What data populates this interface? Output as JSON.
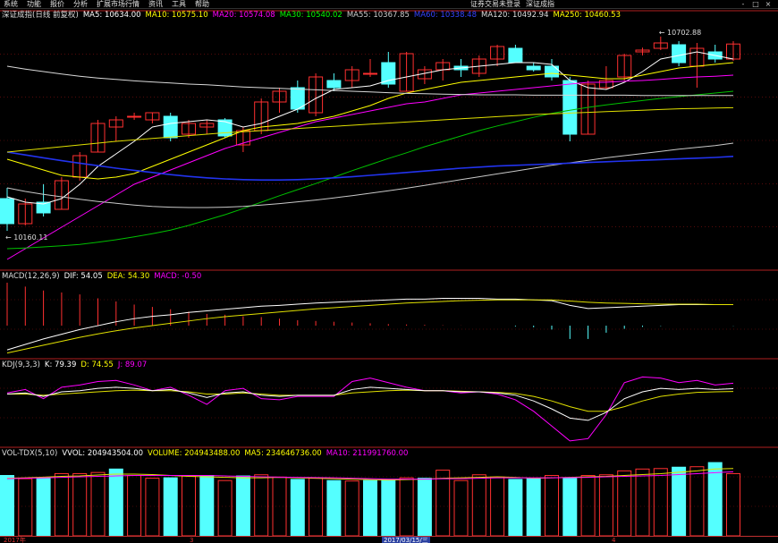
{
  "menu": {
    "items": [
      "系统",
      "功能",
      "报价",
      "分析",
      "扩展市场行情",
      "资讯",
      "工具",
      "帮助"
    ],
    "account_status": "证券交易未登录",
    "index_name": "深证成指"
  },
  "window_controls": [
    "-",
    "□",
    "×"
  ],
  "main_panel": {
    "title": "深证成指(日线 前复权)",
    "indicators": [
      {
        "label": "MA5: 10634.00",
        "color": "#ffffff"
      },
      {
        "label": "MA10: 10575.10",
        "color": "#ffff00"
      },
      {
        "label": "MA20: 10574.08",
        "color": "#ff00ff"
      },
      {
        "label": "MA30: 10540.02",
        "color": "#00ff00"
      },
      {
        "label": "MA55: 10367.85",
        "color": "#cccccc"
      },
      {
        "label": "MA60: 10338.48",
        "color": "#3344ff"
      },
      {
        "label": "MA120: 10492.94",
        "color": "#dddddd"
      },
      {
        "label": "MA250: 10460.53",
        "color": "#ffff00"
      }
    ],
    "high_marker": "10702.88",
    "low_marker": "10160.11"
  },
  "macd_panel": {
    "title": "MACD(12,26,9)",
    "indicators": [
      {
        "label": "DIF: 54.05",
        "color": "#ffffff"
      },
      {
        "label": "DEA: 54.30",
        "color": "#ffff00"
      },
      {
        "label": "MACD: -0.50",
        "color": "#ff00ff"
      }
    ]
  },
  "kdj_panel": {
    "title": "KDJ(9,3,3)",
    "indicators": [
      {
        "label": "K: 79.39",
        "color": "#ffffff"
      },
      {
        "label": "D: 74.55",
        "color": "#ffff00"
      },
      {
        "label": "J: 89.07",
        "color": "#ff00ff"
      }
    ]
  },
  "vol_panel": {
    "title": "VOL-TDX(5,10)",
    "indicators": [
      {
        "label": "VVOL: 204943504.00",
        "color": "#ffffff"
      },
      {
        "label": "VOLUME: 204943488.00",
        "color": "#ffff00"
      },
      {
        "label": "MA5: 234646736.00",
        "color": "#ffff00"
      },
      {
        "label": "MA10: 211991760.00",
        "color": "#ff00ff"
      }
    ]
  },
  "date_axis": {
    "labels": [
      "2017年",
      "3",
      "2017/03/15/三",
      "4"
    ],
    "selected": "2017/03/15/三"
  },
  "colors": {
    "up": "#ff3030",
    "down": "#54ffff",
    "grid": "#8a1010",
    "bg": "#000000"
  },
  "chart_data": {
    "type": "candlestick",
    "candles": [
      {
        "o": 10250,
        "h": 10280,
        "l": 10160,
        "c": 10180
      },
      {
        "o": 10180,
        "h": 10250,
        "l": 10175,
        "c": 10235
      },
      {
        "o": 10240,
        "h": 10290,
        "l": 10200,
        "c": 10210
      },
      {
        "o": 10220,
        "h": 10310,
        "l": 10220,
        "c": 10300
      },
      {
        "o": 10310,
        "h": 10380,
        "l": 10300,
        "c": 10370
      },
      {
        "o": 10380,
        "h": 10470,
        "l": 10380,
        "c": 10460
      },
      {
        "o": 10450,
        "h": 10480,
        "l": 10410,
        "c": 10470
      },
      {
        "o": 10480,
        "h": 10490,
        "l": 10470,
        "c": 10480
      },
      {
        "o": 10470,
        "h": 10490,
        "l": 10460,
        "c": 10490
      },
      {
        "o": 10480,
        "h": 10490,
        "l": 10410,
        "c": 10420
      },
      {
        "o": 10430,
        "h": 10470,
        "l": 10420,
        "c": 10460
      },
      {
        "o": 10450,
        "h": 10470,
        "l": 10430,
        "c": 10460
      },
      {
        "o": 10470,
        "h": 10475,
        "l": 10420,
        "c": 10425
      },
      {
        "o": 10400,
        "h": 10450,
        "l": 10380,
        "c": 10440
      },
      {
        "o": 10440,
        "h": 10530,
        "l": 10430,
        "c": 10520
      },
      {
        "o": 10520,
        "h": 10560,
        "l": 10490,
        "c": 10550
      },
      {
        "o": 10560,
        "h": 10580,
        "l": 10490,
        "c": 10500
      },
      {
        "o": 10490,
        "h": 10600,
        "l": 10480,
        "c": 10590
      },
      {
        "o": 10580,
        "h": 10600,
        "l": 10550,
        "c": 10560
      },
      {
        "o": 10580,
        "h": 10620,
        "l": 10560,
        "c": 10610
      },
      {
        "o": 10600,
        "h": 10640,
        "l": 10590,
        "c": 10600
      },
      {
        "o": 10630,
        "h": 10660,
        "l": 10560,
        "c": 10570
      },
      {
        "o": 10550,
        "h": 10660,
        "l": 10550,
        "c": 10655
      },
      {
        "o": 10585,
        "h": 10620,
        "l": 10570,
        "c": 10610
      },
      {
        "o": 10610,
        "h": 10640,
        "l": 10580,
        "c": 10630
      },
      {
        "o": 10620,
        "h": 10640,
        "l": 10590,
        "c": 10610
      },
      {
        "o": 10600,
        "h": 10650,
        "l": 10590,
        "c": 10640
      },
      {
        "o": 10640,
        "h": 10680,
        "l": 10620,
        "c": 10675
      },
      {
        "o": 10670,
        "h": 10680,
        "l": 10630,
        "c": 10630
      },
      {
        "o": 10620,
        "h": 10630,
        "l": 10605,
        "c": 10610
      },
      {
        "o": 10620,
        "h": 10640,
        "l": 10580,
        "c": 10590
      },
      {
        "o": 10580,
        "h": 10590,
        "l": 10410,
        "c": 10430
      },
      {
        "o": 10430,
        "h": 10580,
        "l": 10430,
        "c": 10570
      },
      {
        "o": 10560,
        "h": 10620,
        "l": 10555,
        "c": 10580
      },
      {
        "o": 10590,
        "h": 10655,
        "l": 10580,
        "c": 10650
      },
      {
        "o": 10660,
        "h": 10672,
        "l": 10650,
        "c": 10665
      },
      {
        "o": 10670,
        "h": 10703,
        "l": 10665,
        "c": 10685
      },
      {
        "o": 10680,
        "h": 10690,
        "l": 10620,
        "c": 10630
      },
      {
        "o": 10620,
        "h": 10685,
        "l": 10560,
        "c": 10670
      },
      {
        "o": 10660,
        "h": 10680,
        "l": 10630,
        "c": 10640
      },
      {
        "o": 10640,
        "h": 10690,
        "l": 10635,
        "c": 10682
      }
    ],
    "ylim": [
      10060,
      10715
    ],
    "ma_lines": {
      "MA5": [
        10255,
        10240,
        10235,
        10250,
        10290,
        10340,
        10375,
        10410,
        10450,
        10460,
        10465,
        10470,
        10465,
        10450,
        10460,
        10480,
        10500,
        10530,
        10555,
        10560,
        10565,
        10580,
        10590,
        10600,
        10610,
        10615,
        10620,
        10625,
        10630,
        10630,
        10625,
        10580,
        10560,
        10555,
        10575,
        10605,
        10640,
        10650,
        10660,
        10650,
        10640
      ],
      "MA10": [
        10360,
        10345,
        10330,
        10315,
        10310,
        10305,
        10310,
        10320,
        10340,
        10360,
        10380,
        10400,
        10420,
        10440,
        10450,
        10455,
        10460,
        10470,
        10480,
        10495,
        10510,
        10530,
        10545,
        10555,
        10565,
        10575,
        10580,
        10585,
        10590,
        10595,
        10600,
        10595,
        10590,
        10585,
        10585,
        10595,
        10605,
        10615,
        10620,
        10625,
        10630
      ],
      "MA20": [
        10080,
        10110,
        10140,
        10170,
        10200,
        10230,
        10260,
        10290,
        10310,
        10330,
        10350,
        10370,
        10390,
        10405,
        10420,
        10435,
        10450,
        10465,
        10475,
        10485,
        10495,
        10505,
        10515,
        10520,
        10530,
        10540,
        10545,
        10550,
        10555,
        10560,
        10565,
        10570,
        10575,
        10575,
        10578,
        10580,
        10583,
        10587,
        10590,
        10592,
        10595
      ],
      "MA30": [
        10110,
        10112,
        10115,
        10118,
        10122,
        10128,
        10135,
        10143,
        10152,
        10162,
        10175,
        10190,
        10205,
        10222,
        10240,
        10258,
        10275,
        10292,
        10310,
        10328,
        10345,
        10362,
        10378,
        10395,
        10410,
        10425,
        10440,
        10453,
        10465,
        10477,
        10488,
        10497,
        10505,
        10512,
        10518,
        10524,
        10530,
        10535,
        10540,
        10545,
        10550
      ],
      "MA55": [
        10280,
        10270,
        10262,
        10255,
        10248,
        10242,
        10237,
        10232,
        10228,
        10226,
        10225,
        10225,
        10226,
        10228,
        10232,
        10236,
        10241,
        10246,
        10252,
        10258,
        10265,
        10272,
        10279,
        10287,
        10295,
        10303,
        10311,
        10319,
        10327,
        10335,
        10343,
        10350,
        10357,
        10364,
        10370,
        10376,
        10382,
        10388,
        10393,
        10398,
        10405
      ],
      "MA60": [
        10380,
        10372,
        10364,
        10356,
        10349,
        10342,
        10335,
        10329,
        10323,
        10317,
        10312,
        10308,
        10305,
        10303,
        10302,
        10302,
        10303,
        10305,
        10308,
        10311,
        10315,
        10319,
        10323,
        10327,
        10331,
        10335,
        10338,
        10341,
        10343,
        10345,
        10347,
        10349,
        10351,
        10353,
        10355,
        10357,
        10359,
        10361,
        10363,
        10365,
        10368
      ],
      "MA120": [
        10620,
        10612,
        10605,
        10598,
        10592,
        10587,
        10583,
        10579,
        10576,
        10573,
        10570,
        10568,
        10565,
        10562,
        10560,
        10558,
        10556,
        10554,
        10552,
        10550,
        10548,
        10546,
        10544,
        10543,
        10542,
        10541,
        10540,
        10540,
        10540,
        10539,
        10539,
        10539,
        10539,
        10539,
        10539,
        10538,
        10538,
        10538,
        10538,
        10538,
        10538
      ],
      "MA250": [
        10380,
        10385,
        10390,
        10395,
        10400,
        10405,
        10410,
        10414,
        10418,
        10422,
        10426,
        10430,
        10434,
        10437,
        10440,
        10443,
        10446,
        10449,
        10452,
        10455,
        10458,
        10461,
        10464,
        10467,
        10470,
        10473,
        10476,
        10479,
        10482,
        10485,
        10487,
        10489,
        10491,
        10493,
        10495,
        10497,
        10499,
        10501,
        10502,
        10503,
        10504
      ]
    },
    "macd": {
      "hist": [
        110,
        100,
        90,
        85,
        80,
        70,
        62,
        54,
        48,
        42,
        36,
        30,
        28,
        24,
        22,
        18,
        14,
        12,
        10,
        8,
        6,
        4,
        3,
        2,
        1,
        0.5,
        0,
        0,
        -2,
        -4,
        -10,
        -34,
        -34,
        -18,
        -8,
        -3,
        -1,
        0,
        0,
        0,
        -0.5
      ],
      "dif": [
        -62,
        -48,
        -34,
        -22,
        -10,
        0,
        10,
        18,
        24,
        28,
        34,
        38,
        42,
        46,
        50,
        52,
        55,
        58,
        60,
        62,
        64,
        66,
        68,
        68,
        70,
        70,
        70,
        68,
        68,
        66,
        64,
        52,
        44,
        46,
        48,
        50,
        52,
        54,
        54,
        54,
        54
      ],
      "dea": [
        -70,
        -60,
        -50,
        -40,
        -30,
        -21,
        -13,
        -6,
        0,
        6,
        12,
        18,
        23,
        27,
        31,
        35,
        39,
        43,
        46,
        49,
        52,
        55,
        58,
        60,
        62,
        64,
        65,
        66,
        66,
        66,
        66,
        63,
        60,
        58,
        57,
        56,
        55,
        55,
        55,
        54,
        54
      ],
      "ylim": [
        -80,
        110
      ]
    },
    "kdj": {
      "k": [
        70,
        72,
        66,
        74,
        76,
        80,
        82,
        80,
        76,
        78,
        72,
        64,
        72,
        74,
        68,
        66,
        68,
        68,
        68,
        78,
        82,
        80,
        78,
        76,
        76,
        74,
        74,
        72,
        68,
        58,
        44,
        28,
        24,
        38,
        62,
        74,
        80,
        78,
        80,
        78,
        79.4
      ],
      "d": [
        70,
        70,
        68,
        70,
        72,
        74,
        76,
        77,
        76,
        76,
        74,
        70,
        70,
        72,
        70,
        68,
        68,
        68,
        68,
        72,
        74,
        76,
        77,
        76,
        76,
        75,
        74,
        73,
        71,
        66,
        58,
        48,
        40,
        40,
        48,
        58,
        66,
        70,
        73,
        74,
        74.5
      ],
      "j": [
        72,
        78,
        62,
        82,
        86,
        92,
        94,
        86,
        76,
        82,
        68,
        52,
        76,
        80,
        62,
        60,
        66,
        66,
        66,
        92,
        98,
        90,
        82,
        76,
        76,
        72,
        74,
        70,
        60,
        40,
        14,
        -12,
        -8,
        34,
        90,
        100,
        98,
        90,
        94,
        86,
        89
      ],
      "ylim": [
        -20,
        110
      ]
    },
    "volume": {
      "values": [
        262,
        248,
        250,
        270,
        270,
        275,
        290,
        262,
        250,
        252,
        260,
        262,
        240,
        260,
        265,
        255,
        245,
        250,
        240,
        238,
        240,
        245,
        252,
        250,
        285,
        240,
        265,
        255,
        245,
        248,
        262,
        250,
        262,
        265,
        282,
        290,
        292,
        298,
        300,
        318,
        270
      ],
      "up": [
        false,
        true,
        false,
        true,
        true,
        true,
        false,
        true,
        true,
        false,
        true,
        false,
        true,
        false,
        true,
        true,
        false,
        true,
        false,
        true,
        false,
        false,
        true,
        false,
        true,
        true,
        true,
        true,
        false,
        false,
        true,
        false,
        true,
        true,
        true,
        true,
        true,
        false,
        true,
        false,
        true
      ],
      "ma5": [
        250,
        252,
        255,
        258,
        260,
        264,
        268,
        268,
        266,
        262,
        258,
        256,
        254,
        252,
        252,
        254,
        252,
        250,
        248,
        246,
        244,
        242,
        244,
        246,
        250,
        252,
        254,
        256,
        254,
        250,
        252,
        254,
        256,
        258,
        262,
        266,
        270,
        276,
        282,
        290,
        292
      ],
      "ma10": [
        248,
        250,
        252,
        254,
        256,
        258,
        260,
        262,
        262,
        262,
        262,
        262,
        260,
        258,
        256,
        255,
        254,
        253,
        252,
        250,
        248,
        246,
        246,
        246,
        248,
        248,
        250,
        252,
        252,
        252,
        252,
        253,
        254,
        256,
        258,
        260,
        262,
        266,
        270,
        274,
        278
      ],
      "ylim": [
        0,
        330
      ]
    }
  }
}
